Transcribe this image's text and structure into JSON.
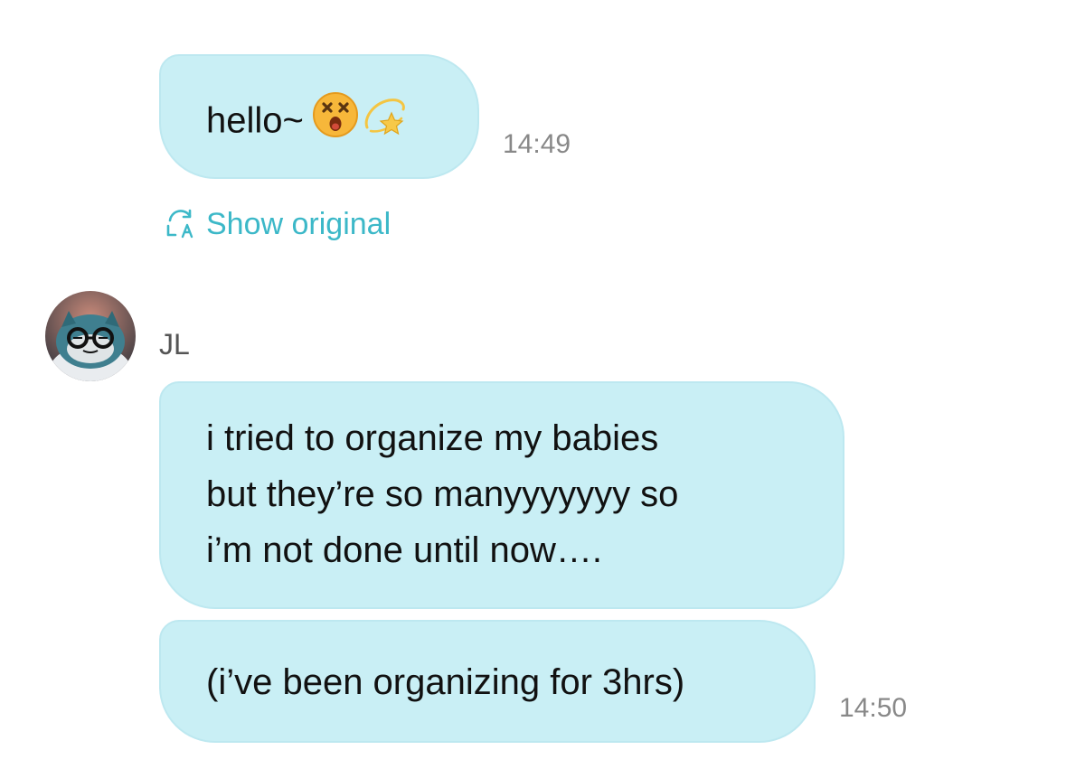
{
  "messages": [
    {
      "text": "hello~",
      "time": "14:49",
      "emojis": [
        "dizzy-face-emoji",
        "dizzy-star-emoji"
      ],
      "translation_toggle_label": "Show original"
    },
    {
      "sender": "JL",
      "avatar_icon": "snorlax-avatar",
      "bubbles": [
        {
          "text": "i tried to organize my babies\nbut they’re so manyyyyyyy so\ni’m not done until now…."
        },
        {
          "text": "(i’ve been organizing for 3hrs)"
        }
      ],
      "time": "14:50"
    }
  ],
  "colors": {
    "bubble_bg": "#c9eff5",
    "bubble_border": "#bde8f0",
    "accent": "#3cb8c8",
    "timestamp": "#888888",
    "sender_name": "#555555"
  }
}
